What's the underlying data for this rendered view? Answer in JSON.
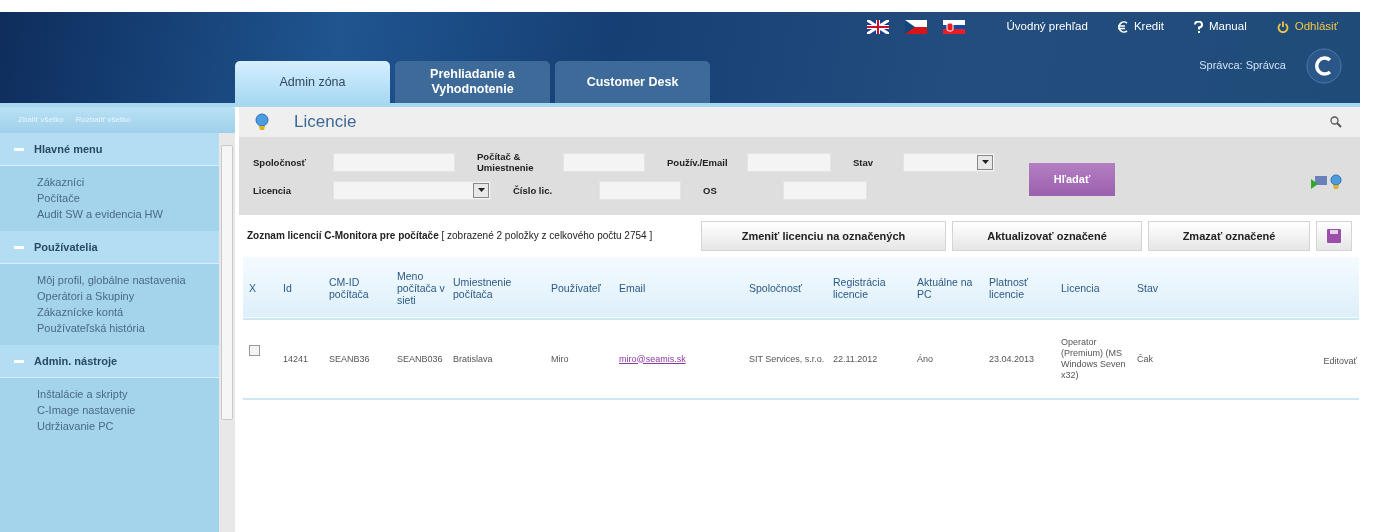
{
  "header": {
    "languages": [
      {
        "kind": "uk"
      },
      {
        "kind": "cz"
      },
      {
        "kind": "sk"
      }
    ],
    "links": [
      {
        "kind": "home",
        "label": "Úvodný prehľad"
      },
      {
        "kind": "euro",
        "label": "Kredit"
      },
      {
        "kind": "help",
        "label": "Manual"
      },
      {
        "kind": "power",
        "label": "Odhlásiť"
      }
    ],
    "tabs": [
      {
        "label": "Admin zóna",
        "selected": true
      },
      {
        "label": "Prehliadanie a Vyhodnotenie",
        "selected": false
      },
      {
        "label": "Customer Desk",
        "selected": false
      }
    ],
    "user": "Správca: Správca"
  },
  "sidebar": {
    "collapse_all": "Zbaliť všetko",
    "expand_all": "Rozbaliť všetko",
    "groups": [
      {
        "title": "Hlavné menu",
        "expanded": true,
        "items": [
          "Zákazníci",
          "Počítače",
          "Audit SW a evidencia HW"
        ]
      },
      {
        "title": "Používatelia",
        "expanded": true,
        "items": [
          "Môj profil, globálne nastavenia",
          "Operátori a Skupiny",
          "Zákaznícke kontá",
          "Používateľská história"
        ]
      },
      {
        "title": "Admin. nástroje",
        "expanded": true,
        "items": [
          "Inštalácie a skripty",
          "C-Image nastavenie",
          "Udržiavanie PC"
        ]
      }
    ]
  },
  "page": {
    "title": "Licencie",
    "filters": [
      [
        {
          "label": "Spoločnosť",
          "kind": "text"
        },
        {
          "label": "Počítač & Umiestnenie",
          "kind": "text"
        },
        {
          "label": "Použív./Email",
          "kind": "text"
        },
        {
          "label": "Stav",
          "kind": "select"
        }
      ],
      [
        {
          "label": "Licencia",
          "kind": "select"
        },
        {
          "label": "Číslo lic.",
          "kind": "text"
        },
        {
          "label": "OS",
          "kind": "text"
        }
      ]
    ],
    "search_button": "Hľadať",
    "list_caption": "**Zoznam licencií C-Monitora pre počítače** [ zobrazené 2 položky z celkového počtu 2754 ]",
    "actions": [
      "Zmeniť licenciu na označených",
      "Aktualizovať označené",
      "Zmazať označené"
    ],
    "table": {
      "columns": [
        "X",
        "Id",
        "CM-ID počítača",
        "Meno počítača v sieti",
        "Umiestnenie počítača",
        "Používateľ",
        "Email",
        "Spoločnosť",
        "Registrácia licencie",
        "Aktuálne na PC",
        "Platnosť licencie",
        "Licencia",
        "Stav"
      ],
      "rows": [
        {
          "checked": false,
          "cells": [
            "",
            "14241",
            "SEANB36",
            "SEANB036",
            "Bratislava",
            "Miro",
            "miro@seamis.sk",
            "SIT Services, s.r.o.",
            "22.11.2012",
            "Áno",
            "23.04.2013",
            "Operator (Premium) (MS Windows Seven x32)",
            "Čak"
          ],
          "edit": "Editovať"
        }
      ]
    }
  }
}
